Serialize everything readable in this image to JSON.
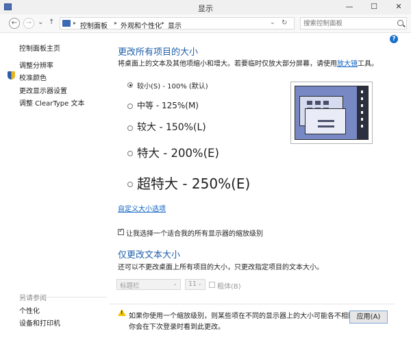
{
  "window": {
    "title": "显示",
    "minimize": "—",
    "maximize": "☐",
    "close": "✕"
  },
  "address": {
    "back": "←",
    "forward": "→",
    "dropdown": "⌄",
    "up": "↑",
    "crumbs": [
      "控制面板",
      "外观和个性化",
      "显示"
    ],
    "path_chevron": "⌄",
    "refresh": "↻",
    "search_placeholder": "搜索控制面板"
  },
  "help": "?",
  "sidebar": {
    "home": "控制面板主页",
    "links": [
      "调整分辨率",
      "校准颜色",
      "更改显示器设置",
      "调整 ClearType 文本"
    ],
    "see_also_title": "另请参阅",
    "see_also": [
      "个性化",
      "设备和打印机"
    ]
  },
  "main": {
    "section1_title": "更改所有项目的大小",
    "section1_desc_prefix": "将桌面上的文本及其他项缩小和增大。若要临时仅放大部分屏幕，请使用",
    "section1_desc_link": "放大镜",
    "section1_desc_suffix": "工具。",
    "options": [
      {
        "label": "较小(S) - 100% (默认)",
        "selected": true
      },
      {
        "label": "中等 - 125%(M)",
        "selected": false
      },
      {
        "label": "较大 - 150%(L)",
        "selected": false
      },
      {
        "label": "特大 - 200%(E)",
        "selected": false
      },
      {
        "label": "超特大 - 250%(E)",
        "selected": false
      }
    ],
    "custom_link": "自定义大小选项",
    "checkbox_label": "让我选择一个适合我的所有显示器的缩放级别",
    "checkbox_checked": true,
    "section2_title": "仅更改文本大小",
    "section2_desc": "还可以不更改桌面上所有项目的大小，只更改指定项目的文本大小。",
    "item_select": "标题栏",
    "size_select": "11",
    "bold_label": "粗体(B)",
    "select_arrow": "⌄",
    "warning_line1": "如果你使用一个缩放级别，则某些项在不同的显示器上的大小可能各不相同。",
    "warning_line2": "你会在下次登录时看到此更改。",
    "warning_mark": "!",
    "apply_label": "应用(A)"
  },
  "colors": {
    "heading_blue": "#1f5fa9",
    "link_blue": "#0b61c2",
    "preview_screen": "#7788c4"
  }
}
